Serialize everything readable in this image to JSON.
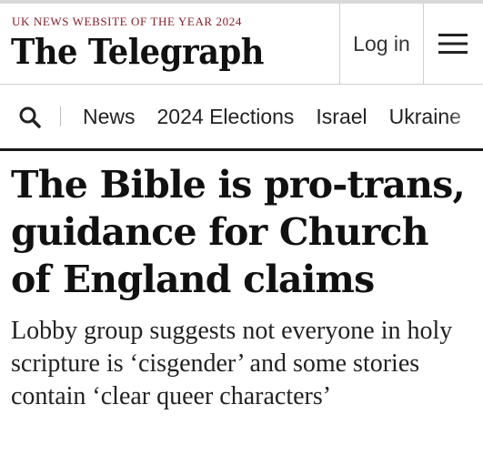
{
  "header": {
    "award_text": "UK NEWS WEBSITE OF THE YEAR 2024",
    "logo_text": "The Telegraph",
    "login_label": "Log in",
    "menu_icon": "hamburger-menu-icon"
  },
  "nav": {
    "search_icon": "search-icon",
    "items": [
      {
        "label": "News"
      },
      {
        "label": "2024 Elections"
      },
      {
        "label": "Israel"
      },
      {
        "label": "Ukraine"
      }
    ]
  },
  "article": {
    "headline": "The Bible is pro-trans, guidance for Church of England claims",
    "standfirst": "Lobby group suggests not everyone in holy scripture is ‘cisgender’ and some stories contain ‘clear queer characters’"
  },
  "colors": {
    "award": "#8a1c28",
    "text": "#111111",
    "divider": "#cfcfcf"
  }
}
